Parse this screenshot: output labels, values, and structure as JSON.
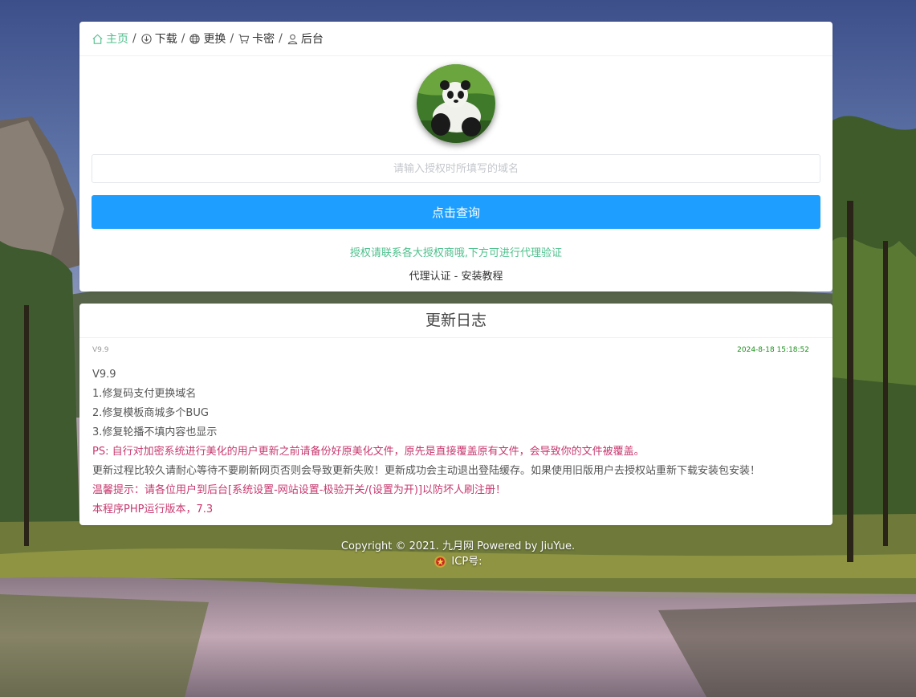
{
  "nav": {
    "items": [
      {
        "label": "主页",
        "icon": "home-icon",
        "active": true
      },
      {
        "label": "下载",
        "icon": "download-icon",
        "active": false
      },
      {
        "label": "更换",
        "icon": "globe-icon",
        "active": false
      },
      {
        "label": "卡密",
        "icon": "cart-icon",
        "active": false
      },
      {
        "label": "后台",
        "icon": "user-icon",
        "active": false
      }
    ],
    "separator": "/"
  },
  "query": {
    "input_placeholder": "请输入授权时所填写的域名",
    "input_value": "",
    "button_label": "点击查询",
    "notice": "授权请联系各大授权商哦,下方可进行代理验证",
    "link_agent": "代理认证",
    "link_sep": " - ",
    "link_tutorial": "安装教程"
  },
  "changelog": {
    "title": "更新日志",
    "version_tag": "V9.9",
    "date": "2024-8-18 15:18:52",
    "lines": [
      "V9.9",
      "1.修复码支付更换域名",
      "2.修复模板商城多个BUG",
      "3.修复轮播不填内容也显示",
      "PS: 自行对加密系统进行美化的用户更新之前请备份好原美化文件，原先是直接覆盖原有文件，会导致你的文件被覆盖。",
      "更新过程比较久请耐心等待不要刷新网页否则会导致更新失败！更新成功会主动退出登陆缓存。如果使用旧版用户去授权站重新下载安装包安装！",
      "温馨提示：请各位用户到后台[系统设置-网站设置-极验开关/(设置为开)]以防坏人刷注册！",
      "本程序PHP运行版本，7.3"
    ]
  },
  "footer": {
    "copyright": "Copyright © 2021. 九月网 Powered by JiuYue.",
    "icp": "ICP号:"
  },
  "colors": {
    "accent_green": "#4fc08d",
    "button_blue": "#1e9fff",
    "warning_red": "#c7386e",
    "date_green": "#1c8f1c"
  }
}
